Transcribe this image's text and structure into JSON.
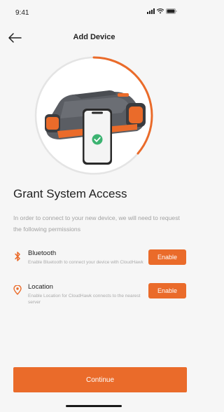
{
  "status_bar": {
    "time": "9:41"
  },
  "header": {
    "title": "Add Device"
  },
  "main": {
    "title": "Grant System Access",
    "description": "In order to connect to your new device, we will need to request the following permissions"
  },
  "permissions": [
    {
      "name": "Bluetooth",
      "description": "Enable Bluetooth to connect your device with CloudHawk",
      "button_label": "Enable",
      "icon": "bluetooth-icon"
    },
    {
      "name": "Location",
      "description": "Enable Location for CloudHawk connects to the nearest server",
      "button_label": "Enable",
      "icon": "location-pin-icon"
    }
  ],
  "footer": {
    "continue_label": "Continue"
  },
  "colors": {
    "accent": "#ea6b2a",
    "background": "#f6f6f6",
    "mower_body": "#5a5d63",
    "check": "#3cb371"
  }
}
